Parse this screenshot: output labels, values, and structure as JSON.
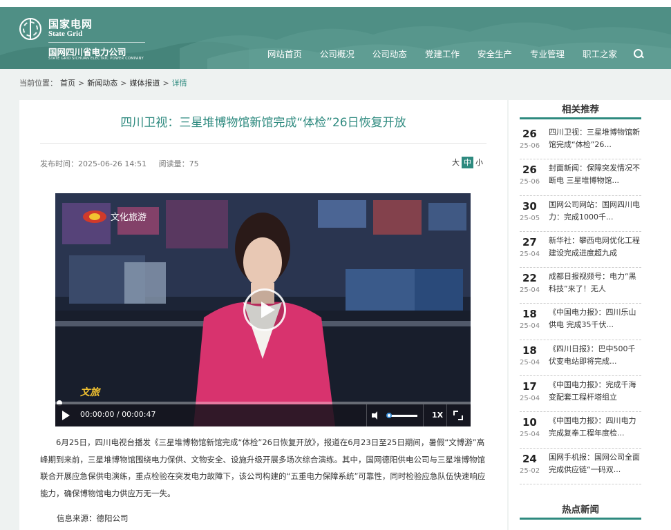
{
  "brand": {
    "name_cn": "国家电网",
    "name_en": "State Grid",
    "company": "国网四川省电力公司",
    "company_en": "STATE GRID SICHUAN ELECTRIC POWER COMPANY"
  },
  "nav": {
    "items": [
      "网站首页",
      "公司概况",
      "公司动态",
      "党建工作",
      "安全生产",
      "专业管理",
      "职工之家"
    ],
    "search_icon": "search-icon"
  },
  "breadcrumb": {
    "prefix": "当前位置：",
    "items": [
      "首页",
      "新闻动态",
      "媒体报道"
    ],
    "current": "详情",
    "separator": ">"
  },
  "article": {
    "title": "四川卫视：三星堆博物馆新馆完成“体检”26日恢复开放",
    "publish_time": "发布时间：2025-06-26 14:51",
    "read_count": "阅读量：75",
    "font_sizes": [
      "大",
      "中",
      "小"
    ],
    "font_active": "中",
    "body": "6月25日，四川电视台播发《三星堆博物馆新馆完成“体检”26日恢复开放》，报道在6月23日至25日期间，暑假“文博游”高峰期到来前，三星堆博物馆围绕电力保供、文物安全、设施升级开展多场次综合演练。其中，国网德阳供电公司与三星堆博物馆联合开展应急保供电演练，重点检验在突发电力故障下，该公司构建的“五重电力保障系统”可靠性，同时检验应急队伍快速响应能力，确保博物馆电力供应万无一失。",
    "source": "信息来源：德阳公司"
  },
  "video": {
    "channel_logo": "文化旅游",
    "corner_logo": "文旅",
    "time": "00:00:00 / 00:00:47",
    "speed": "1X",
    "progress_fraction": 0.0,
    "volume_fraction": 0.0
  },
  "sidebar": {
    "title": "相关推荐",
    "items": [
      {
        "day": "26",
        "ym": "25-06",
        "text": "四川卫视：三星堆博物馆新馆完成“体检”26..."
      },
      {
        "day": "26",
        "ym": "25-06",
        "text": "封面新闻：保障突发情况不断电 三星堆博物馆..."
      },
      {
        "day": "30",
        "ym": "25-05",
        "text": "国网公司网站：国网四川电力：完成1000千..."
      },
      {
        "day": "27",
        "ym": "25-04",
        "text": "新华社：攀西电网优化工程建设完成进度超九成"
      },
      {
        "day": "22",
        "ym": "25-04",
        "text": "成都日报视频号：电力“黑科技”来了！无人"
      },
      {
        "day": "18",
        "ym": "25-04",
        "text": "《中国电力报》：四川乐山供电 完成35千伏..."
      },
      {
        "day": "18",
        "ym": "25-04",
        "text": "《四川日报》：巴中500千伏变电站即将完成..."
      },
      {
        "day": "17",
        "ym": "25-04",
        "text": "《中国电力报》：完成千海变配套工程杆塔组立"
      },
      {
        "day": "10",
        "ym": "25-04",
        "text": "《中国电力报》：四川电力完成复奉工程年度检..."
      },
      {
        "day": "24",
        "ym": "25-02",
        "text": "国网手机报：国网公司全面完成供应链“一码双..."
      }
    ],
    "title2": "热点新闻"
  },
  "colors": {
    "header": "#4f8f85",
    "accent": "#2e8a7f"
  }
}
